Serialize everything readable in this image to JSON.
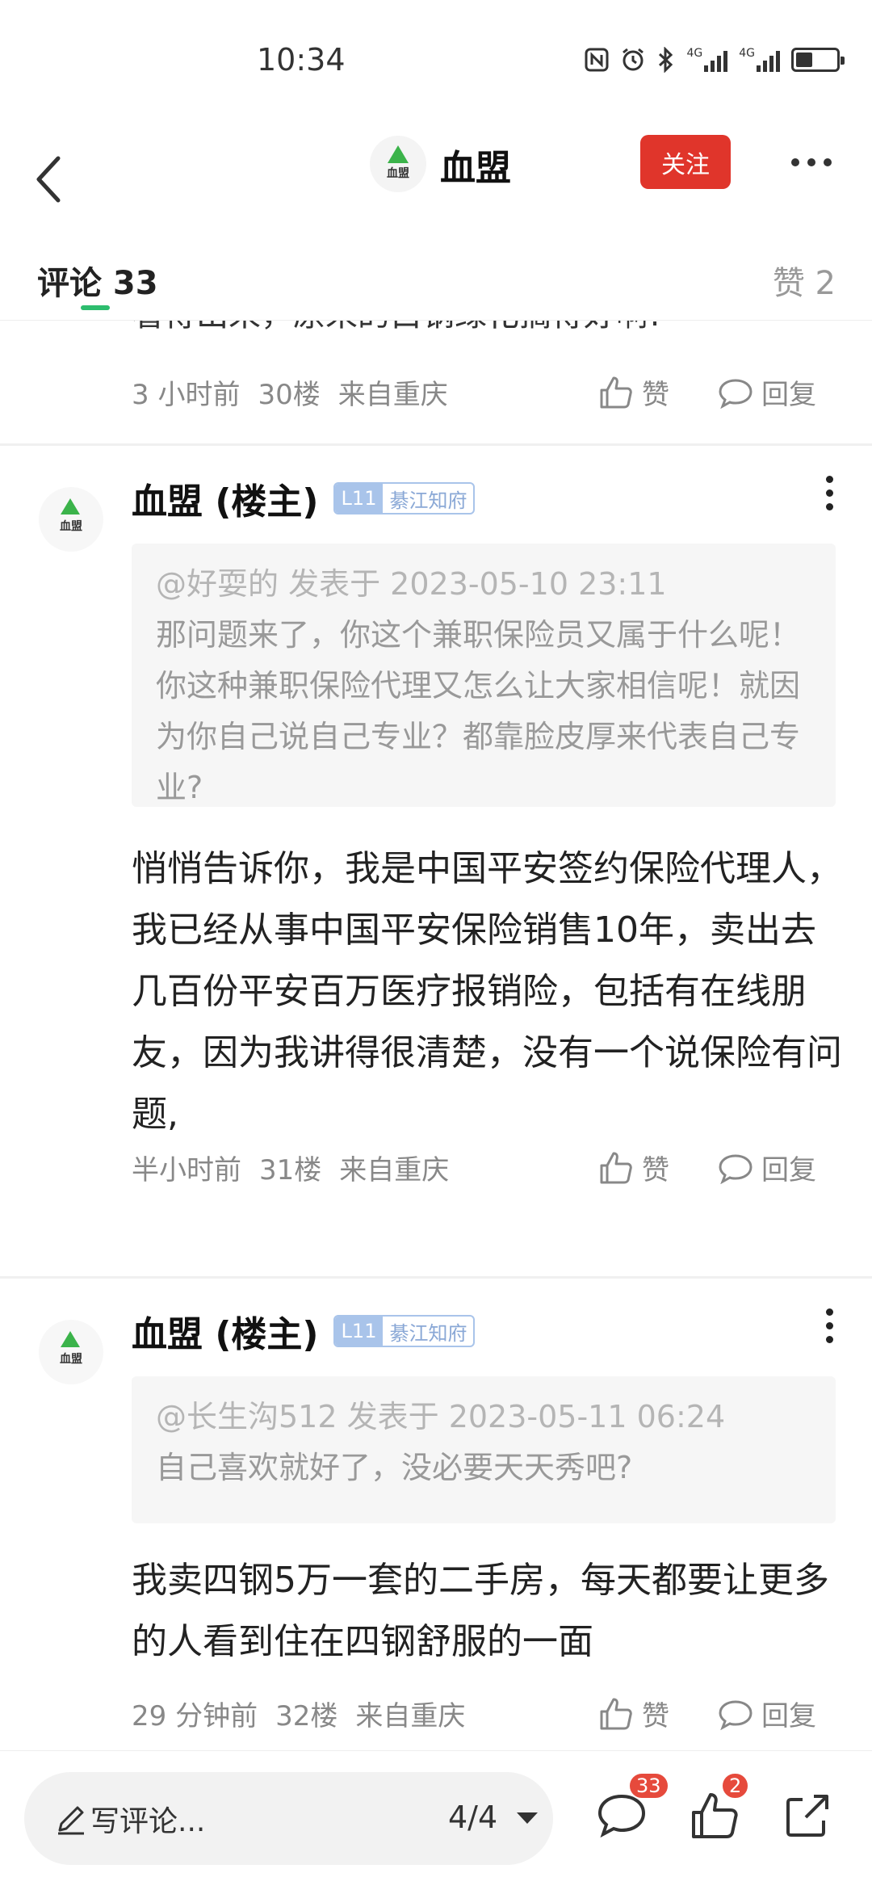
{
  "status_bar": {
    "time": "10:34",
    "signal1_label": "4G",
    "signal2_label": "4G"
  },
  "header": {
    "back_icon": "chevron-left-icon",
    "logo_text": "血盟",
    "title": "血盟",
    "follow_label": "关注",
    "more_icon": "more-horizontal-icon"
  },
  "tabs": {
    "comments_label": "评论 33",
    "likes_label": "赞 2"
  },
  "partial_comment": {
    "text": "看得出来，原来的白钢绿化搞得好啊!",
    "meta": [
      "3 小时前",
      "30楼",
      "来自重庆"
    ],
    "like_label": "赞",
    "reply_label": "回复"
  },
  "comments": [
    {
      "author": "血盟 (楼主)",
      "badge_level": "L11",
      "badge_name": "綦江知府",
      "quote_head": "@好耍的 发表于 2023-05-10 23:11",
      "quote_body": "那问题来了，你这个兼职保险员又属于什么呢！你这种兼职保险代理又怎么让大家相信呢！就因为你自己说自己专业？都靠脸皮厚来代表自己专业?",
      "body": "悄悄告诉你，我是中国平安签约保险代理人，我已经从事中国平安保险销售10年，卖出去几百份平安百万医疗报销险，包括有在线朋友，因为我讲得很清楚，没有一个说保险有问题,",
      "time": "半小时前",
      "floor": "31楼",
      "location": "来自重庆",
      "like_label": "赞",
      "reply_label": "回复"
    },
    {
      "author": "血盟 (楼主)",
      "badge_level": "L11",
      "badge_name": "綦江知府",
      "quote_head": "@长生沟512 发表于 2023-05-11 06:24",
      "quote_body": "自己喜欢就好了，没必要天天秀吧?",
      "body": "我卖四钢5万一套的二手房，每天都要让更多的人看到住在四钢舒服的一面",
      "time": "29 分钟前",
      "floor": "32楼",
      "location": "来自重庆",
      "like_label": "赞",
      "reply_label": "回复"
    }
  ],
  "bottom_bar": {
    "input_placeholder": "写评论...",
    "page_indicator": "4/4",
    "comment_count": "33",
    "like_count": "2",
    "icons": [
      "pen-icon",
      "comment-icon",
      "thumbs-up-icon",
      "share-icon"
    ]
  },
  "colors": {
    "accent_red": "#e0352b",
    "tab_underline": "#2dbd6e",
    "badge_blue": "#a9c4ea"
  }
}
